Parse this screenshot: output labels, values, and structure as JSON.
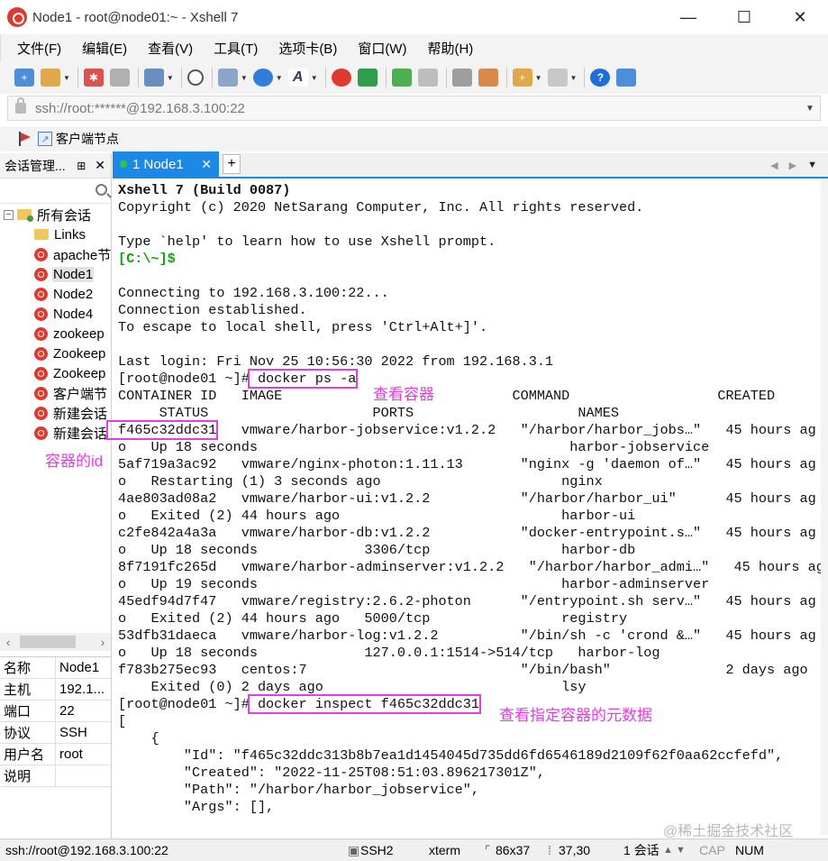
{
  "window": {
    "title": "Node1 - root@node01:~ - Xshell 7",
    "minimize": "—",
    "maximize": "☐",
    "close": "✕"
  },
  "menu": [
    "文件(F)",
    "编辑(E)",
    "查看(V)",
    "工具(T)",
    "选项卡(B)",
    "窗口(W)",
    "帮助(H)"
  ],
  "address": {
    "text": "ssh://root:******@192.168.3.100:22"
  },
  "links": {
    "client_node": "客户端节点"
  },
  "sidebar": {
    "title": "会话管理...",
    "pin": "⊞",
    "close": "✕",
    "root_label": "所有会话",
    "items": [
      "Links",
      "apache节",
      "Node1",
      "Node2",
      "Node4",
      "zookeep",
      "Zookeep",
      "Zookeep",
      "客户端节",
      "新建会话",
      "新建会话"
    ]
  },
  "properties": [
    {
      "key": "名称",
      "value": "Node1"
    },
    {
      "key": "主机",
      "value": "192.1..."
    },
    {
      "key": "端口",
      "value": "22"
    },
    {
      "key": "协议",
      "value": "SSH"
    },
    {
      "key": "用户名",
      "value": "root"
    },
    {
      "key": "说明",
      "value": ""
    }
  ],
  "tab": {
    "label": "1 Node1",
    "close": "✕",
    "add": "+"
  },
  "terminal": {
    "lines": [
      "Xshell 7 (Build 0087)",
      "Copyright (c) 2020 NetSarang Computer, Inc. All rights reserved.",
      "",
      "Type `help' to learn how to use Xshell prompt.",
      "[C:\\~]$",
      "",
      "Connecting to 192.168.3.100:22...",
      "Connection established.",
      "To escape to local shell, press 'Ctrl+Alt+]'.",
      "",
      "Last login: Fri Nov 25 10:56:30 2022 from 192.168.3.1",
      "[root@node01 ~]# docker ps -a",
      "CONTAINER ID   IMAGE                            COMMAND                  CREATED     ",
      "     STATUS                    PORTS                    NAMES",
      "f465c32ddc31   vmware/harbor-jobservice:v1.2.2   \"/harbor/harbor_jobs…\"   45 hours ag",
      "o   Up 18 seconds                                      harbor-jobservice",
      "5af719a3ac92   vmware/nginx-photon:1.11.13       \"nginx -g 'daemon of…\"   45 hours ag",
      "o   Restarting (1) 3 seconds ago                      nginx",
      "4ae803ad08a2   vmware/harbor-ui:v1.2.2           \"/harbor/harbor_ui\"      45 hours ag",
      "o   Exited (2) 44 hours ago                           harbor-ui",
      "c2fe842a4a3a   vmware/harbor-db:v1.2.2           \"docker-entrypoint.s…\"   45 hours ag",
      "o   Up 18 seconds             3306/tcp                harbor-db",
      "8f7191fc265d   vmware/harbor-adminserver:v1.2.2   \"/harbor/harbor_admi…\"   45 hours ag",
      "o   Up 19 seconds                                     harbor-adminserver",
      "45edf94d7f47   vmware/registry:2.6.2-photon      \"/entrypoint.sh serv…\"   45 hours ag",
      "o   Exited (2) 44 hours ago   5000/tcp                registry",
      "53dfb31daeca   vmware/harbor-log:v1.2.2          \"/bin/sh -c 'crond &…\"   45 hours ag",
      "o   Up 18 seconds             127.0.0.1:1514->514/tcp   harbor-log",
      "f783b275ec93   centos:7                          \"/bin/bash\"              2 days ago",
      "    Exited (0) 2 days ago                             lsy",
      "[root@node01 ~]# docker inspect f465c32ddc31",
      "[",
      "    {",
      "        \"Id\": \"f465c32ddc313b8b7ea1d1454045d735dd6fd6546189d2109f62f0aa62ccfefd\",",
      "        \"Created\": \"2022-11-25T08:51:03.896217301Z\",",
      "        \"Path\": \"/harbor/harbor_jobservice\",",
      "        \"Args\": [],"
    ]
  },
  "annotations": {
    "view_containers": "查看容器",
    "container_id": "容器的id",
    "view_metadata": "查看指定容器的元数据"
  },
  "status": {
    "connection": "ssh://root@192.168.3.100:22",
    "protocol": "SSH2",
    "terminal": "xterm",
    "size": "86x37",
    "cursor": "37,30",
    "sessions": "1 会话",
    "cap": "CAP",
    "num": "NUM"
  },
  "watermark": "@稀土掘金技术社区"
}
